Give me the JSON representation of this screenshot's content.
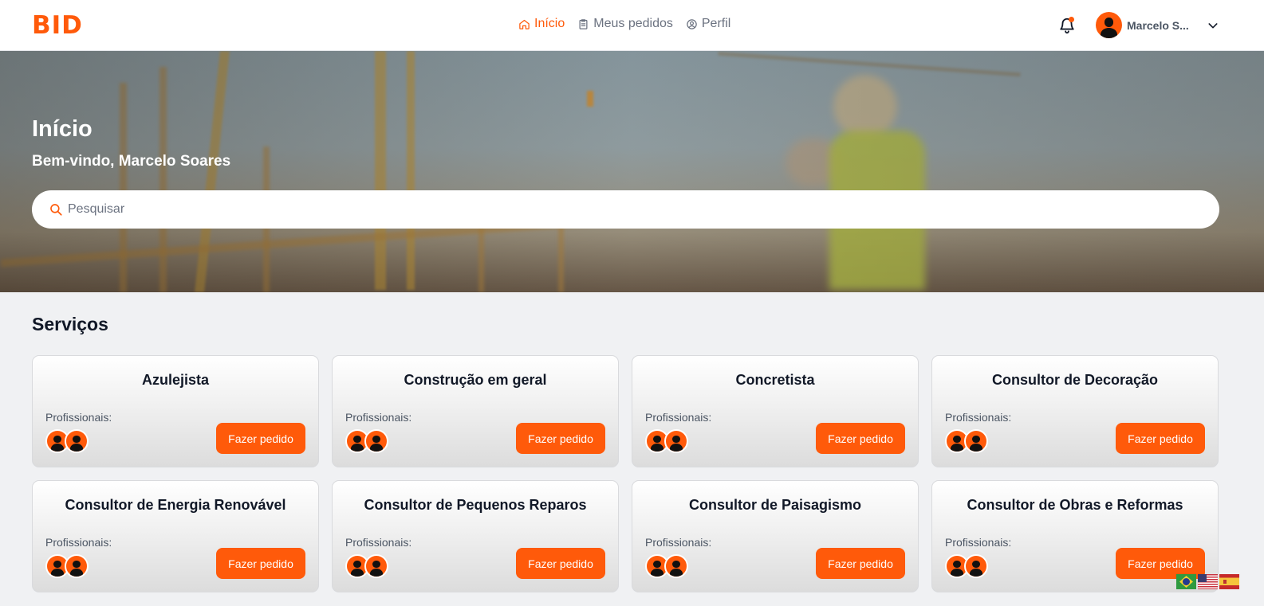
{
  "header": {
    "logo": "BID",
    "nav": [
      {
        "label": "Início",
        "icon": "home-icon",
        "active": true
      },
      {
        "label": "Meus pedidos",
        "icon": "clipboard-icon",
        "active": false
      },
      {
        "label": "Perfil",
        "icon": "user-circle-icon",
        "active": false
      }
    ],
    "notification_icon": "bell-icon",
    "user_name": "Marcelo S...",
    "user_menu_icon": "chevron-down-icon"
  },
  "hero": {
    "title": "Início",
    "subtitle": "Bem-vindo, Marcelo Soares",
    "search": {
      "placeholder": "Pesquisar",
      "value": ""
    }
  },
  "services": {
    "title": "Serviços",
    "label": "Profissionais:",
    "button_label": "Fazer pedido",
    "items": [
      {
        "title": "Azulejista"
      },
      {
        "title": "Construção em geral"
      },
      {
        "title": "Concretista"
      },
      {
        "title": "Consultor de Decoração"
      },
      {
        "title": "Consultor de Energia Renovável"
      },
      {
        "title": "Consultor de Pequenos Reparos"
      },
      {
        "title": "Consultor de Paisagismo"
      },
      {
        "title": "Consultor de Obras e Reformas"
      }
    ]
  },
  "languages": [
    {
      "flag": "brazil-flag-icon"
    },
    {
      "flag": "usa-flag-icon"
    },
    {
      "flag": "spain-flag-icon"
    }
  ],
  "colors": {
    "accent": "#ff5a0a",
    "page_bg": "#f0f1f3"
  }
}
